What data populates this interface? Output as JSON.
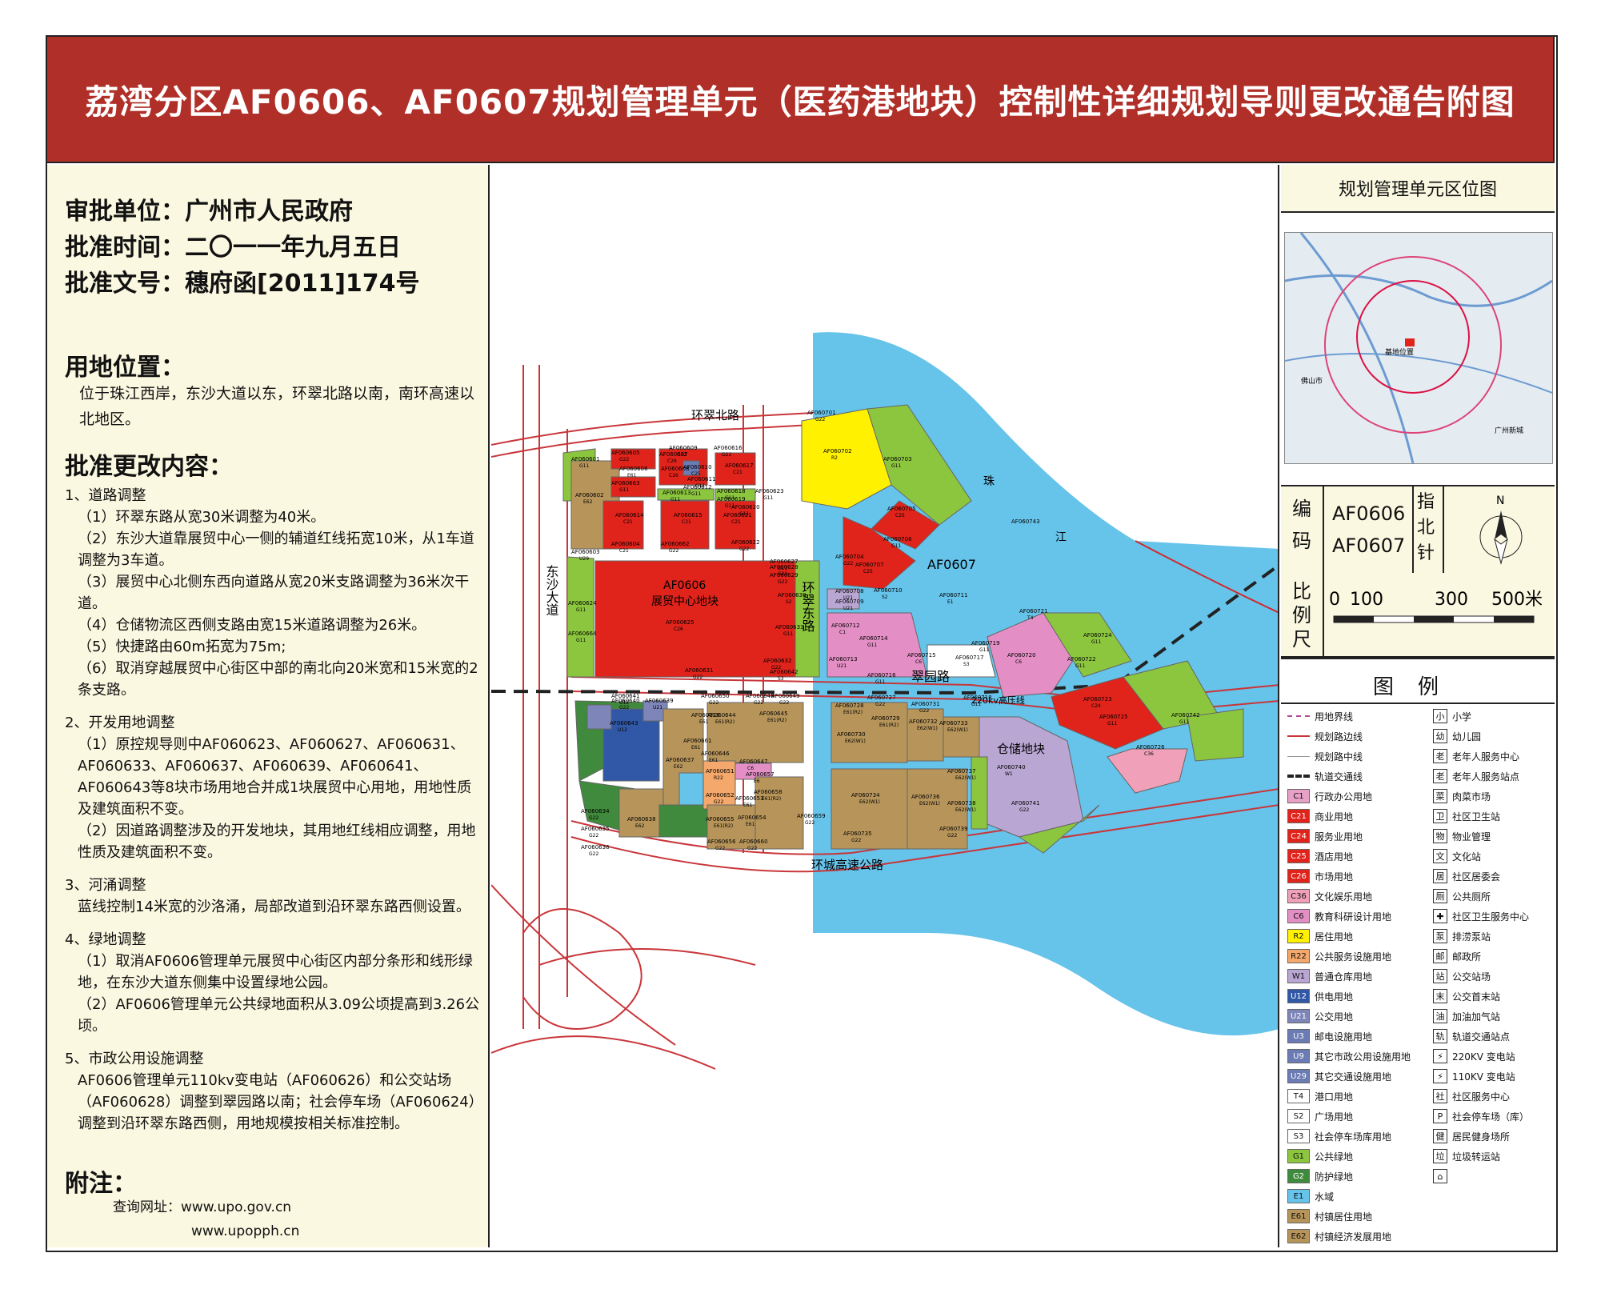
{
  "title": "荔湾分区AF0606、AF0607规划管理单元（医药港地块）控制性详细规划导则更改通告附图",
  "approval": {
    "unit": "审批单位：广州市人民政府",
    "date": "批准时间：二〇一一年九月五日",
    "doc": "批准文号：穗府函[2011]174号"
  },
  "location": {
    "heading": "用地位置：",
    "text": "位于珠江西岸，东沙大道以东，环翠北路以南，南环高速以北地区。"
  },
  "changes": {
    "heading": "批准更改内容：",
    "road_title": "1、道路调整",
    "road_1": "（1）环翠东路从宽30米调整为40米。",
    "road_2": "（2）东沙大道靠展贸中心一侧的辅道红线拓宽10米，从1车道调整为3车道。",
    "road_3": "（3）展贸中心北侧东西向道路从宽20米支路调整为36米次干道。",
    "road_4": "（4）仓储物流区西侧支路由宽15米道路调整为26米。",
    "road_5": "（5）快捷路由60m拓宽为75m;",
    "road_6": "（6）取消穿越展贸中心街区中部的南北向20米宽和15米宽的2条支路。",
    "land_title": "2、开发用地调整",
    "land_1": "（1）原控规导则中AF060623、AF060627、AF060631、AF060633、AF060637、AF060639、AF060641、AF060643等8块市场用地合并成1块展贸中心用地，用地性质及建筑面积不变。",
    "land_2": "（2）因道路调整涉及的开发地块，其用地红线相应调整，用地性质及建筑面积不变。",
    "river_title": "3、河涌调整",
    "river_1": "蓝线控制14米宽的沙洛涌，局部改道到沿环翠东路西侧设置。",
    "green_title": "4、绿地调整",
    "green_1": "（1）取消AF0606管理单元展贸中心街区内部分条形和线形绿地，在东沙大道东侧集中设置绿地公园。",
    "green_2": "（2）AF0606管理单元公共绿地面积从3.09公顷提高到3.26公顷。",
    "utility_title": "5、市政公用设施调整",
    "utility_1": "AF0606管理单元110kv变电站（AF060626）和公交站场（AF060628）调整到翠园路以南；社会停车场（AF060624）调整到沿环翠东路西侧，用地规模按相关标准控制。"
  },
  "notes": {
    "heading": "附注：",
    "url_1": "查询网址：www.upo.gov.cn",
    "url_2": "www.upopph.cn"
  },
  "map": {
    "roads": {
      "north": "环翠北路",
      "east": "环翠东路",
      "cuiyuan": "翠园路",
      "dongsha": "东沙大道",
      "ring": "环城高速公路",
      "line220": "220kv高压线"
    },
    "areas": {
      "af0606": "AF0606",
      "expo": "展贸中心地块",
      "af0607": "AF0607",
      "storage": "仓储地块",
      "river_zhu": "珠",
      "river_jiang": "江"
    },
    "parcels": [
      {
        "id": "AF060601",
        "code": "G11"
      },
      {
        "id": "AF060602",
        "code": "E62"
      },
      {
        "id": "AF060603",
        "code": "U29"
      },
      {
        "id": "AF060604",
        "code": "C21"
      },
      {
        "id": "AF060605",
        "code": "G22"
      },
      {
        "id": "AF060606",
        "code": "E61"
      },
      {
        "id": "AF060607",
        "code": "C26"
      },
      {
        "id": "AF060608",
        "code": "C26"
      },
      {
        "id": "AF060609",
        "code": "G22"
      },
      {
        "id": "AF060610",
        "code": "C25"
      },
      {
        "id": "AF060611",
        "code": "G11"
      },
      {
        "id": "AF060612",
        "code": "G11"
      },
      {
        "id": "AF060613",
        "code": "G11"
      },
      {
        "id": "AF060614",
        "code": "C21"
      },
      {
        "id": "AF060615",
        "code": "C21"
      },
      {
        "id": "AF060616",
        "code": "G22"
      },
      {
        "id": "AF060617",
        "code": "C21"
      },
      {
        "id": "AF060618",
        "code": "G11"
      },
      {
        "id": "AF060619",
        "code": "G11"
      },
      {
        "id": "AF060620",
        "code": "G11"
      },
      {
        "id": "AF060621",
        "code": "C21"
      },
      {
        "id": "AF060622",
        "code": "G22"
      },
      {
        "id": "AF060623",
        "code": "G11"
      },
      {
        "id": "AF060624",
        "code": "G11"
      },
      {
        "id": "AF060625",
        "code": "C26"
      },
      {
        "id": "AF060626",
        "code": "E61"
      },
      {
        "id": "AF060627",
        "code": "G11"
      },
      {
        "id": "AF060628",
        "code": "G22"
      },
      {
        "id": "AF060629",
        "code": "G22"
      },
      {
        "id": "AF060630",
        "code": "S2"
      },
      {
        "id": "AF060631",
        "code": "G22"
      },
      {
        "id": "AF060632",
        "code": "G22"
      },
      {
        "id": "AF060633",
        "code": "G11"
      },
      {
        "id": "AF060634",
        "code": "G22"
      },
      {
        "id": "AF060635",
        "code": "G22"
      },
      {
        "id": "AF060636",
        "code": "G22"
      },
      {
        "id": "AF060637",
        "code": "E62"
      },
      {
        "id": "AF060638",
        "code": "E62"
      },
      {
        "id": "AF060639",
        "code": "U21"
      },
      {
        "id": "AF060640",
        "code": "G22"
      },
      {
        "id": "AF060641",
        "code": "U12"
      },
      {
        "id": "AF060642",
        "code": "S3"
      },
      {
        "id": "AF060643",
        "code": "U12"
      },
      {
        "id": "AF060644",
        "code": "E61(R2)"
      },
      {
        "id": "AF060645",
        "code": "E61(R2)"
      },
      {
        "id": "AF060646",
        "code": "E61"
      },
      {
        "id": "AF060647",
        "code": "C6"
      },
      {
        "id": "AF060648",
        "code": "G22"
      },
      {
        "id": "AF060649",
        "code": "G22"
      },
      {
        "id": "AF060650",
        "code": "G22"
      },
      {
        "id": "AF060651",
        "code": "R22"
      },
      {
        "id": "AF060652",
        "code": "G22"
      },
      {
        "id": "AF060653",
        "code": "E61"
      },
      {
        "id": "AF060654",
        "code": "E61"
      },
      {
        "id": "AF060655",
        "code": "E61(R2)"
      },
      {
        "id": "AF060656",
        "code": "G22"
      },
      {
        "id": "AF060657",
        "code": "E6"
      },
      {
        "id": "AF060658",
        "code": "E61(R2)"
      },
      {
        "id": "AF060659",
        "code": "G22"
      },
      {
        "id": "AF060660",
        "code": "G22"
      },
      {
        "id": "AF060661",
        "code": "E61"
      },
      {
        "id": "AF060662",
        "code": "G22"
      },
      {
        "id": "AF060663",
        "code": "G11"
      },
      {
        "id": "AF060664",
        "code": "G11"
      },
      {
        "id": "AF060701",
        "code": "G22"
      },
      {
        "id": "AF060702",
        "code": "R2"
      },
      {
        "id": "AF060703",
        "code": "G11"
      },
      {
        "id": "AF060704",
        "code": "G22"
      },
      {
        "id": "AF060705",
        "code": "C25"
      },
      {
        "id": "AF060706",
        "code": "G11"
      },
      {
        "id": "AF060707",
        "code": "C25"
      },
      {
        "id": "AF060708",
        "code": "U21"
      },
      {
        "id": "AF060709",
        "code": "U21"
      },
      {
        "id": "AF060710",
        "code": "S2"
      },
      {
        "id": "AF060711",
        "code": "E1"
      },
      {
        "id": "AF060712",
        "code": "C1"
      },
      {
        "id": "AF060713",
        "code": "U21"
      },
      {
        "id": "AF060714",
        "code": "G11"
      },
      {
        "id": "AF060715",
        "code": "C6"
      },
      {
        "id": "AF060716",
        "code": "G11"
      },
      {
        "id": "AF060717",
        "code": "S3"
      },
      {
        "id": "AF060718",
        "code": "G11"
      },
      {
        "id": "AF060719",
        "code": "G11"
      },
      {
        "id": "AF060720",
        "code": "C6"
      },
      {
        "id": "AF060721",
        "code": "T4"
      },
      {
        "id": "AF060722",
        "code": "G11"
      },
      {
        "id": "AF060723",
        "code": "C24"
      },
      {
        "id": "AF060724",
        "code": "G11"
      },
      {
        "id": "AF060725",
        "code": "G11"
      },
      {
        "id": "AF060726",
        "code": "C36"
      },
      {
        "id": "AF060727",
        "code": "G22"
      },
      {
        "id": "AF060728",
        "code": "E61(R2)"
      },
      {
        "id": "AF060729",
        "code": "E61(R2)"
      },
      {
        "id": "AF060730",
        "code": "E62(W1)"
      },
      {
        "id": "AF060731",
        "code": "G22"
      },
      {
        "id": "AF060732",
        "code": "E62(W1)"
      },
      {
        "id": "AF060733",
        "code": "E62(W1)"
      },
      {
        "id": "AF060734",
        "code": "E62(W1)"
      },
      {
        "id": "AF060735",
        "code": "G22"
      },
      {
        "id": "AF060736",
        "code": "E62(W1)"
      },
      {
        "id": "AF060737",
        "code": "E62(W1)"
      },
      {
        "id": "AF060738",
        "code": "E62(W1)"
      },
      {
        "id": "AF060739",
        "code": "G22"
      },
      {
        "id": "AF060740",
        "code": "W1"
      },
      {
        "id": "AF060741",
        "code": "G22"
      },
      {
        "id": "AF060742",
        "code": "G11"
      },
      {
        "id": "AF060743",
        "code": ""
      }
    ]
  },
  "right": {
    "loc_title": "规划管理单元区位图",
    "code_label_1": "编",
    "code_label_2": "码",
    "code_1": "AF0606",
    "code_2": "AF0607",
    "north_label_1": "指",
    "north_label_2": "北",
    "north_label_3": "针",
    "north_n": "N",
    "scale_label_1": "比",
    "scale_label_2": "例",
    "scale_label_3": "尺",
    "scale_0": "0",
    "scale_100": "100",
    "scale_300": "300",
    "scale_500": "500米",
    "loc_text_1": "基地位置",
    "loc_text_2": "佛山市",
    "loc_text_3": "广州新城"
  },
  "legend": {
    "title": "图例",
    "left": [
      {
        "swatch": "",
        "label": "用地界线",
        "color": "#ffffff",
        "line": "boundary"
      },
      {
        "swatch": "",
        "label": "规划路边线",
        "color": "#ffffff",
        "line": "red"
      },
      {
        "swatch": "",
        "label": "规划路中线",
        "color": "#ffffff",
        "line": "center"
      },
      {
        "swatch": "",
        "label": "轨道交通线",
        "color": "#ffffff",
        "line": "rail"
      },
      {
        "swatch": "C1",
        "label": "行政办公用地",
        "color": "#e7a0c6"
      },
      {
        "swatch": "C21",
        "label": "商业用地",
        "color": "#e0231b"
      },
      {
        "swatch": "C24",
        "label": "服务业用地",
        "color": "#e0231b"
      },
      {
        "swatch": "C25",
        "label": "酒店用地",
        "color": "#e0231b"
      },
      {
        "swatch": "C26",
        "label": "市场用地",
        "color": "#e0231b"
      },
      {
        "swatch": "C36",
        "label": "文化娱乐用地",
        "color": "#f0a0b8"
      },
      {
        "swatch": "C6",
        "label": "教育科研设计用地",
        "color": "#e38fc5"
      },
      {
        "swatch": "R2",
        "label": "居住用地",
        "color": "#fff100"
      },
      {
        "swatch": "R22",
        "label": "公共服务设施用地",
        "color": "#f4a86b"
      },
      {
        "swatch": "W1",
        "label": "普通仓库用地",
        "color": "#b9a6d3"
      },
      {
        "swatch": "U12",
        "label": "供电用地",
        "color": "#3158a6"
      },
      {
        "swatch": "U21",
        "label": "公交用地",
        "color": "#7e85b9"
      },
      {
        "swatch": "U3",
        "label": "邮电设施用地",
        "color": "#6b7bb3"
      },
      {
        "swatch": "U9",
        "label": "其它市政公用设施用地",
        "color": "#6b7bb3"
      },
      {
        "swatch": "U29",
        "label": "其它交通设施用地",
        "color": "#6b7bb3"
      },
      {
        "swatch": "T4",
        "label": "港口用地",
        "color": "#ffffff"
      },
      {
        "swatch": "S2",
        "label": "广场用地",
        "color": "#ffffff"
      },
      {
        "swatch": "S3",
        "label": "社会停车场库用地",
        "color": "#ffffff"
      },
      {
        "swatch": "G1",
        "label": "公共绿地",
        "color": "#8cc63f"
      },
      {
        "swatch": "G2",
        "label": "防护绿地",
        "color": "#3f8a3c"
      },
      {
        "swatch": "E1",
        "label": "水域",
        "color": "#66c3ea"
      },
      {
        "swatch": "E61",
        "label": "村镇居住用地",
        "color": "#b7955a"
      },
      {
        "swatch": "E62",
        "label": "村镇经济发展用地",
        "color": "#b7955a"
      }
    ],
    "right": [
      {
        "sym": "小",
        "label": "小学"
      },
      {
        "sym": "幼",
        "label": "幼儿园"
      },
      {
        "sym": "老",
        "label": "老年人服务中心"
      },
      {
        "sym": "老",
        "label": "老年人服务站点"
      },
      {
        "sym": "菜",
        "label": "肉菜市场"
      },
      {
        "sym": "卫",
        "label": "社区卫生站"
      },
      {
        "sym": "物",
        "label": "物业管理"
      },
      {
        "sym": "文",
        "label": "文化站"
      },
      {
        "sym": "居",
        "label": "社区居委会"
      },
      {
        "sym": "厕",
        "label": "公共厕所"
      },
      {
        "sym": "✚",
        "label": "社区卫生服务中心"
      },
      {
        "sym": "泵",
        "label": "排涝泵站"
      },
      {
        "sym": "邮",
        "label": "邮政所"
      },
      {
        "sym": "站",
        "label": "公交站场"
      },
      {
        "sym": "末",
        "label": "公交首末站"
      },
      {
        "sym": "油",
        "label": "加油加气站"
      },
      {
        "sym": "轨",
        "label": "轨道交通站点"
      },
      {
        "sym": "⚡",
        "label": "220KV 变电站"
      },
      {
        "sym": "⚡",
        "label": "110KV 变电站"
      },
      {
        "sym": "社",
        "label": "社区服务中心"
      },
      {
        "sym": "P",
        "label": "社会停车场（库）"
      },
      {
        "sym": "健",
        "label": "居民健身场所"
      },
      {
        "sym": "垃",
        "label": "垃圾转运站"
      },
      {
        "sym": "⌂",
        "label": ""
      }
    ]
  }
}
